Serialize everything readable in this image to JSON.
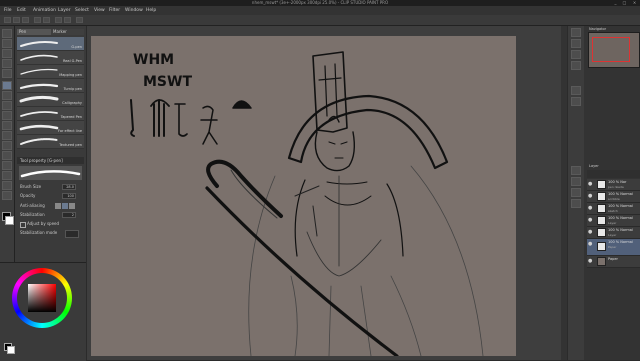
{
  "titlebar": {
    "title": "nhem_mswt* (3e+-2000px 300dpi 25.0%) - CLIP STUDIO PAINT PRO",
    "controls": [
      "_",
      "□",
      "×"
    ]
  },
  "menubar": {
    "items": [
      "File",
      "Edit",
      "Animation",
      "Layer",
      "Select",
      "View",
      "Filter",
      "Window",
      "Help"
    ]
  },
  "subtool": {
    "tabs": [
      "Pen",
      "Marker"
    ],
    "brushes": [
      {
        "label": "G-pen",
        "selected": true
      },
      {
        "label": "Real G-Pen",
        "selected": false
      },
      {
        "label": "Mapping pen",
        "selected": false
      },
      {
        "label": "Turnip pen",
        "selected": false
      },
      {
        "label": "Calligraphy",
        "selected": false
      },
      {
        "label": "Tapered Pen",
        "selected": false
      },
      {
        "label": "For effect line",
        "selected": false
      },
      {
        "label": "Textured pen",
        "selected": false
      }
    ],
    "property_title": "Tool property [G-pen]",
    "props": [
      {
        "label": "Brush Size",
        "value": "28.0"
      },
      {
        "label": "Opacity",
        "value": "100"
      },
      {
        "label": "Anti-aliasing",
        "value": ""
      },
      {
        "label": "Stabilization",
        "value": "2"
      },
      {
        "label": "Adjust by speed",
        "value": ""
      },
      {
        "label": "Stabilization mode",
        "value": ""
      }
    ]
  },
  "canvas": {
    "text_line1": "WHM",
    "text_line2": "MSWT"
  },
  "rightpanel": {
    "navigator_title": "Navigator",
    "layer_title": "Layer",
    "layers": [
      {
        "name": "100 % Nor",
        "sub": "pen nkeda",
        "selected": false
      },
      {
        "name": "100 % Normal",
        "sub": "scribble",
        "selected": false
      },
      {
        "name": "100 % Normal",
        "sub": "sketch",
        "selected": false
      },
      {
        "name": "100 % Normal",
        "sub": "Layer",
        "selected": false
      },
      {
        "name": "100 % Normal",
        "sub": "Layer",
        "selected": false
      },
      {
        "name": "100 % Normal",
        "sub": "Paper",
        "selected": true
      },
      {
        "name": "Paper",
        "sub": "",
        "selected": false
      }
    ]
  }
}
